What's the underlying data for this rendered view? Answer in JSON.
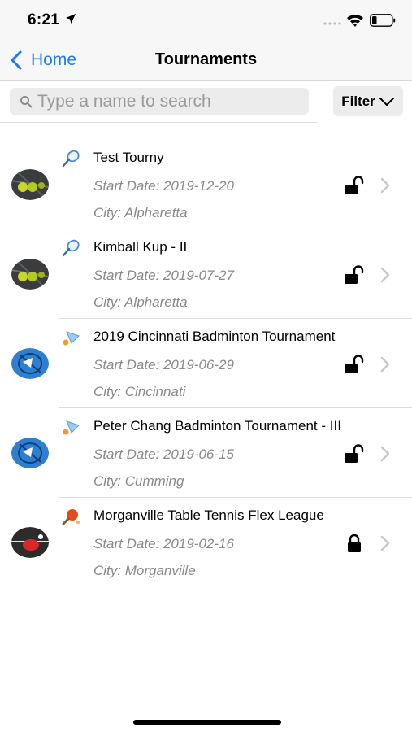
{
  "status": {
    "time": "6:21"
  },
  "nav": {
    "back_label": "Home",
    "title": "Tournaments"
  },
  "search": {
    "placeholder": "Type a name to search",
    "filter_label": "Filter"
  },
  "tournaments": [
    {
      "name": "Test Tourny",
      "start_date": "Start Date: 2019-12-20",
      "city": "City: Alpharetta",
      "sport": "tennis",
      "locked": false
    },
    {
      "name": "Kimball Kup - II",
      "start_date": "Start Date: 2019-07-27",
      "city": "City: Alpharetta",
      "sport": "tennis",
      "locked": false
    },
    {
      "name": "2019 Cincinnati Badminton Tournament",
      "start_date": "Start Date: 2019-06-29",
      "city": "City: Cincinnati",
      "sport": "badminton",
      "locked": false
    },
    {
      "name": "Peter Chang Badminton Tournament - III",
      "start_date": "Start Date: 2019-06-15",
      "city": "City: Cumming",
      "sport": "badminton",
      "locked": false
    },
    {
      "name": "Morganville Table Tennis Flex League",
      "start_date": "Start Date: 2019-02-16",
      "city": "City: Morganville",
      "sport": "table-tennis",
      "locked": true
    }
  ],
  "icons": {
    "tennis": "tennis-racket-icon",
    "badminton": "shuttlecock-icon",
    "table_tennis": "ping-pong-paddle-icon",
    "unlocked": "unlocked-padlock-icon",
    "locked": "locked-padlock-icon",
    "chevron": "chevron-right-icon"
  },
  "colors": {
    "accent": "#1a7cf5",
    "secondary_text": "#8a8a8a"
  }
}
